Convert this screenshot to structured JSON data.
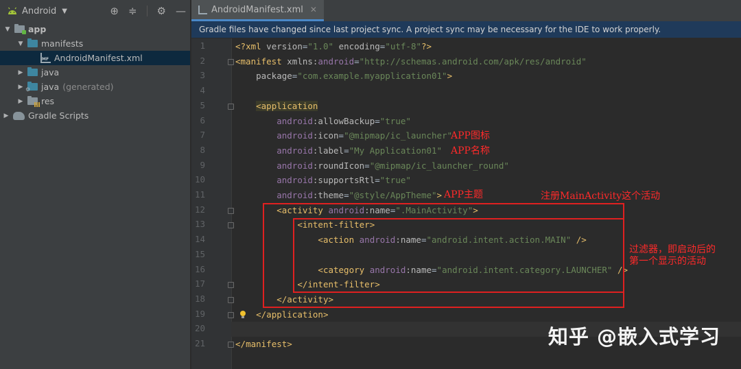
{
  "project": {
    "title": "Android",
    "tree": [
      {
        "label": "app",
        "depth": 0,
        "arrow": "▼",
        "icon": "app-module-icon",
        "style": "bold"
      },
      {
        "label": "manifests",
        "depth": 1,
        "arrow": "▼",
        "icon": "folder-icon",
        "style": ""
      },
      {
        "label": "AndroidManifest.xml",
        "depth": 2,
        "arrow": "",
        "icon": "manifest-file-icon",
        "style": "",
        "selected": true
      },
      {
        "label": "java",
        "depth": 1,
        "arrow": "▶",
        "icon": "java-folder-icon",
        "style": ""
      },
      {
        "label": "java",
        "suffix": "(generated)",
        "depth": 1,
        "arrow": "▶",
        "icon": "generated-folder-icon",
        "style": ""
      },
      {
        "label": "res",
        "depth": 1,
        "arrow": "▶",
        "icon": "res-folder-icon",
        "style": ""
      },
      {
        "label": "Gradle Scripts",
        "depth": 0,
        "arrow": "▶",
        "icon": "gradle-icon",
        "style": "",
        "root": true
      }
    ]
  },
  "editor": {
    "tab_label": "AndroidManifest.xml",
    "banner": "Gradle files have changed since last project sync. A project sync may be necessary for the IDE to work properly.",
    "line_numbers": [
      "1",
      "2",
      "3",
      "4",
      "5",
      "6",
      "7",
      "8",
      "9",
      "10",
      "11",
      "12",
      "13",
      "14",
      "15",
      "16",
      "17",
      "18",
      "19",
      "20",
      "21"
    ]
  },
  "code": [
    {
      "indent": "",
      "tokens": [
        [
          "bracket",
          "<?"
        ],
        [
          "tag",
          "xml "
        ],
        [
          "attr",
          "version"
        ],
        [
          "plain",
          "="
        ],
        [
          "val",
          "\"1.0\""
        ],
        [
          "plain",
          " "
        ],
        [
          "attr",
          "encoding"
        ],
        [
          "plain",
          "="
        ],
        [
          "val",
          "\"utf-8\""
        ],
        [
          "bracket",
          "?>"
        ]
      ]
    },
    {
      "indent": "",
      "tokens": [
        [
          "bracket",
          "<"
        ],
        [
          "tag",
          "manifest "
        ],
        [
          "attr",
          "xmlns:"
        ],
        [
          "ns",
          "android"
        ],
        [
          "plain",
          "="
        ],
        [
          "val",
          "\"http://schemas.android.com/apk/res/android\""
        ]
      ]
    },
    {
      "indent": "    ",
      "tokens": [
        [
          "attr",
          "package"
        ],
        [
          "plain",
          "="
        ],
        [
          "val",
          "\"com.example.myapplication01\""
        ],
        [
          "bracket",
          ">"
        ]
      ]
    },
    {
      "indent": "",
      "tokens": []
    },
    {
      "indent": "    ",
      "tokens": [
        [
          "bracket",
          "<"
        ],
        [
          "tag",
          "application"
        ]
      ]
    },
    {
      "indent": "        ",
      "tokens": [
        [
          "ns",
          "android"
        ],
        [
          "attr",
          ":allowBackup"
        ],
        [
          "plain",
          "="
        ],
        [
          "val",
          "\"true\""
        ]
      ]
    },
    {
      "indent": "        ",
      "tokens": [
        [
          "ns",
          "android"
        ],
        [
          "attr",
          ":icon"
        ],
        [
          "plain",
          "="
        ],
        [
          "val",
          "\"@mipmap/ic_launcher\""
        ]
      ]
    },
    {
      "indent": "        ",
      "tokens": [
        [
          "ns",
          "android"
        ],
        [
          "attr",
          ":label"
        ],
        [
          "plain",
          "="
        ],
        [
          "val",
          "\"My Application01\""
        ]
      ]
    },
    {
      "indent": "        ",
      "tokens": [
        [
          "ns",
          "android"
        ],
        [
          "attr",
          ":roundIcon"
        ],
        [
          "plain",
          "="
        ],
        [
          "val",
          "\"@mipmap/ic_launcher_round\""
        ]
      ]
    },
    {
      "indent": "        ",
      "tokens": [
        [
          "ns",
          "android"
        ],
        [
          "attr",
          ":supportsRtl"
        ],
        [
          "plain",
          "="
        ],
        [
          "val",
          "\"true\""
        ]
      ]
    },
    {
      "indent": "        ",
      "tokens": [
        [
          "ns",
          "android"
        ],
        [
          "attr",
          ":theme"
        ],
        [
          "plain",
          "="
        ],
        [
          "val",
          "\"@style/AppTheme\""
        ],
        [
          "bracket",
          ">"
        ]
      ]
    },
    {
      "indent": "        ",
      "tokens": [
        [
          "bracket",
          "<"
        ],
        [
          "tag",
          "activity "
        ],
        [
          "ns",
          "android"
        ],
        [
          "attr",
          ":name"
        ],
        [
          "plain",
          "="
        ],
        [
          "val",
          "\".MainActivity\""
        ],
        [
          "bracket",
          ">"
        ]
      ]
    },
    {
      "indent": "            ",
      "tokens": [
        [
          "bracket",
          "<"
        ],
        [
          "tag",
          "intent-filter"
        ],
        [
          "bracket",
          ">"
        ]
      ]
    },
    {
      "indent": "                ",
      "tokens": [
        [
          "bracket",
          "<"
        ],
        [
          "tag",
          "action "
        ],
        [
          "ns",
          "android"
        ],
        [
          "attr",
          ":name"
        ],
        [
          "plain",
          "="
        ],
        [
          "val",
          "\"android.intent.action.MAIN\""
        ],
        [
          "plain",
          " "
        ],
        [
          "bracket",
          "/>"
        ]
      ]
    },
    {
      "indent": "",
      "tokens": []
    },
    {
      "indent": "                ",
      "tokens": [
        [
          "bracket",
          "<"
        ],
        [
          "tag",
          "category "
        ],
        [
          "ns",
          "android"
        ],
        [
          "attr",
          ":name"
        ],
        [
          "plain",
          "="
        ],
        [
          "val",
          "\"android.intent.category.LAUNCHER\""
        ],
        [
          "plain",
          " "
        ],
        [
          "bracket",
          "/>"
        ]
      ]
    },
    {
      "indent": "            ",
      "tokens": [
        [
          "bracket",
          "</"
        ],
        [
          "tag",
          "intent-filter"
        ],
        [
          "bracket",
          ">"
        ]
      ]
    },
    {
      "indent": "        ",
      "tokens": [
        [
          "bracket",
          "</"
        ],
        [
          "tag",
          "activity"
        ],
        [
          "bracket",
          ">"
        ]
      ]
    },
    {
      "indent": "    ",
      "tokens": [
        [
          "bracket",
          "</"
        ],
        [
          "tag",
          "application"
        ],
        [
          "bracket",
          ">"
        ]
      ]
    },
    {
      "indent": "",
      "tokens": []
    },
    {
      "indent": "",
      "tokens": [
        [
          "bracket",
          "</"
        ],
        [
          "tag",
          "manifest"
        ],
        [
          "bracket",
          ">"
        ]
      ]
    }
  ],
  "annotations": {
    "app_icon": "APP图标",
    "app_name": "APP名称",
    "app_theme": "APP主题",
    "register_activity": "注册MainActivity这个活动",
    "filter_line1": "过滤器，即启动后的",
    "filter_line2": "第一个显示的活动"
  },
  "watermark": "知乎 @嵌入式学习",
  "colors": {
    "background": "#2b2b2b",
    "panel": "#3c3f41",
    "banner": "#1f3a5a",
    "tag": "#e8bf6a",
    "namespace": "#9876aa",
    "value": "#6a8759",
    "annotation": "#ff2a2a"
  }
}
